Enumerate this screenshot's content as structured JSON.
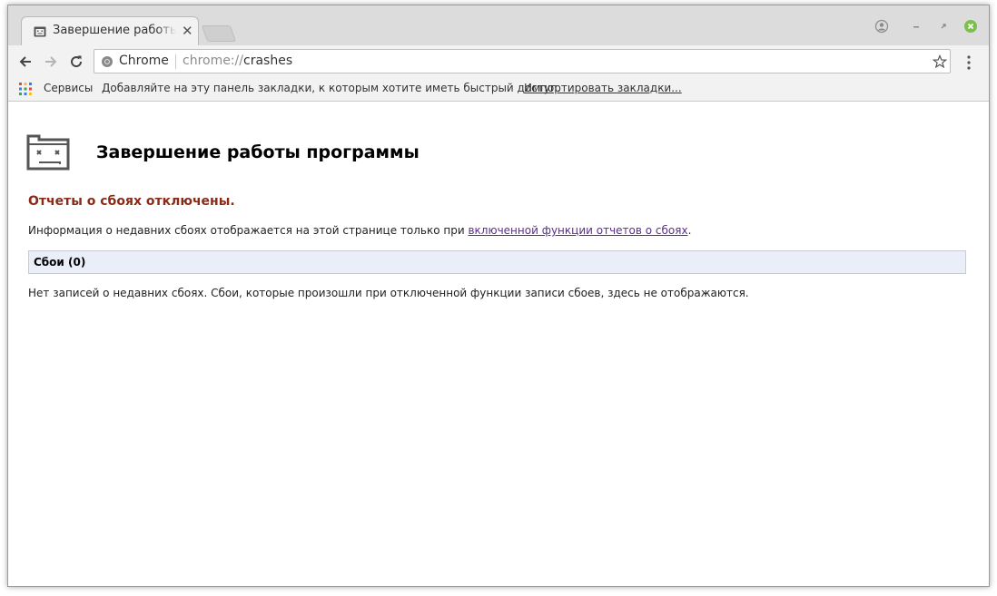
{
  "tab": {
    "title": "Завершение работы программы",
    "close_glyph": "✕"
  },
  "omnibox": {
    "chip": "Chrome",
    "url_scheme": "chrome://",
    "url_host": "crashes"
  },
  "bookmarks": {
    "apps_label": "Сервисы",
    "hint": "Добавляйте на эту панель закладки, к которым хотите иметь быстрый доступ.",
    "import_link": "Импортировать закладки..."
  },
  "page": {
    "title": "Завершение работы программы",
    "disabled_heading": "Отчеты о сбоях отключены.",
    "info_prefix": "Информация о недавних сбоях отображается на этой странице только при ",
    "info_link": "включенной функции отчетов о сбоях",
    "info_suffix": ".",
    "crash_section": "Сбои (0)",
    "no_crashes": "Нет записей о недавних сбоях. Сбои, которые произошли при отключенной функции записи сбоев, здесь не отображаются."
  },
  "colors": {
    "heading_red": "#8b2b17",
    "link_purple": "#5a2d8c",
    "section_bg": "#eaeef8",
    "close_green": "#7cbf4c"
  },
  "icons": {
    "favicon": "sad-folder-icon",
    "back": "arrow-left-icon",
    "forward": "arrow-right-icon",
    "reload": "reload-icon",
    "secure": "chrome-logo-icon",
    "star": "star-icon",
    "menu": "kebab-menu-icon",
    "apps": "apps-grid-icon",
    "profile": "profile-icon",
    "minimize": "minimize-icon",
    "maximize": "maximize-icon",
    "close": "window-close-icon"
  }
}
